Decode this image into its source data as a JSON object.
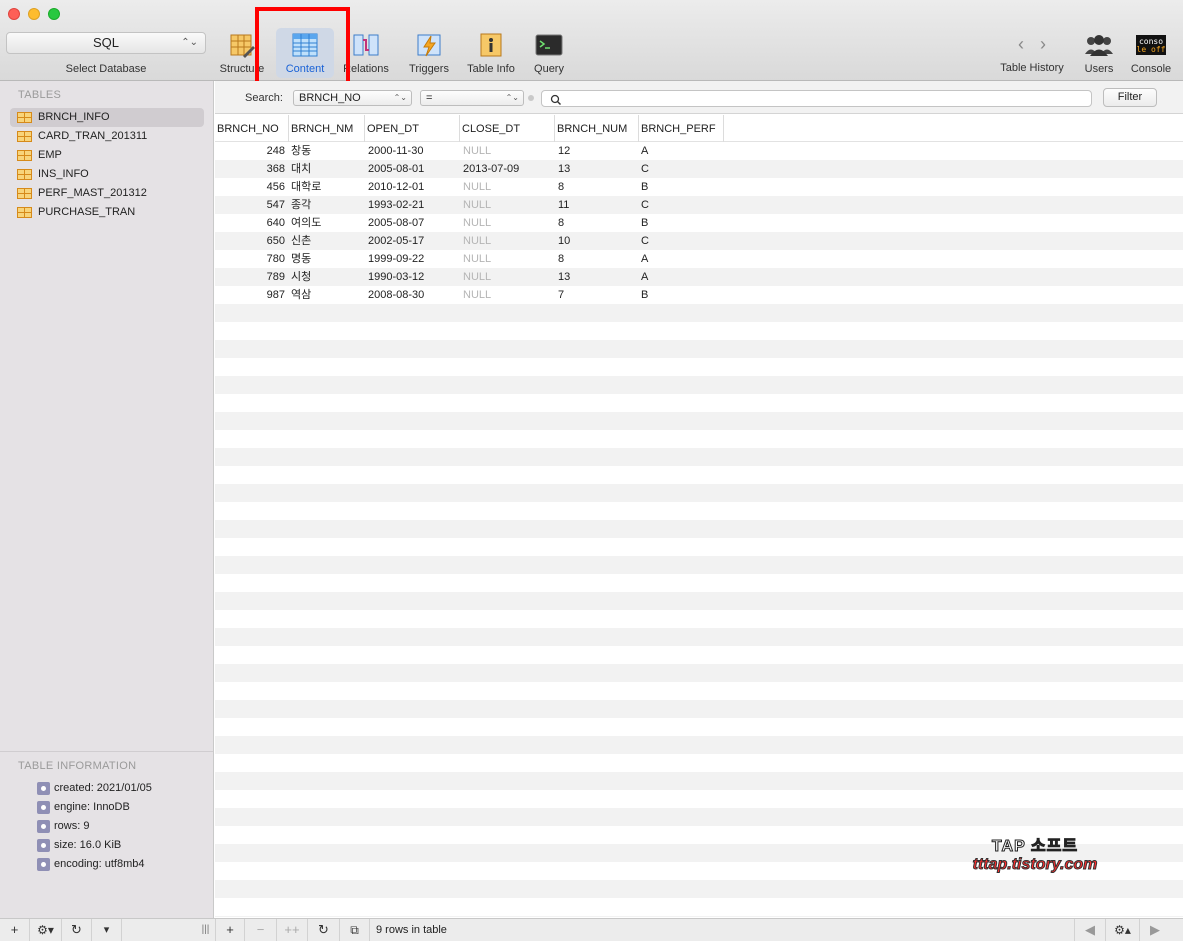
{
  "toolbar": {
    "database": "SQL",
    "database_label": "Select Database",
    "buttons": [
      {
        "label": "Structure"
      },
      {
        "label": "Content"
      },
      {
        "label": "Relations"
      },
      {
        "label": "Triggers"
      },
      {
        "label": "Table Info"
      },
      {
        "label": "Query"
      }
    ],
    "right_buttons": [
      {
        "label": "Table History"
      },
      {
        "label": "Users"
      },
      {
        "label": "Console"
      }
    ],
    "console_icon_text": [
      "conso",
      "le off"
    ],
    "active_button": "Content"
  },
  "sidebar": {
    "tables_heading": "TABLES",
    "tables": [
      "BRNCH_INFO",
      "CARD_TRAN_201311",
      "EMP",
      "INS_INFO",
      "PERF_MAST_201312",
      "PURCHASE_TRAN"
    ],
    "selected_table": "BRNCH_INFO",
    "info_heading": "TABLE INFORMATION",
    "info": [
      "created: 2021/01/05",
      "engine: InnoDB",
      "rows: 9",
      "size: 16.0 KiB",
      "encoding: utf8mb4"
    ]
  },
  "search": {
    "label": "Search:",
    "column": "BRNCH_NO",
    "operator": "=",
    "value": "",
    "filter_label": "Filter"
  },
  "grid": {
    "columns": [
      "BRNCH_NO",
      "BRNCH_NM",
      "OPEN_DT",
      "CLOSE_DT",
      "BRNCH_NUM",
      "BRNCH_PERF"
    ],
    "rows": [
      [
        "248",
        "창동",
        "2000-11-30",
        "NULL",
        "12",
        "A"
      ],
      [
        "368",
        "대치",
        "2005-08-01",
        "2013-07-09",
        "13",
        "C"
      ],
      [
        "456",
        "대학로",
        "2010-12-01",
        "NULL",
        "8",
        "B"
      ],
      [
        "547",
        "종각",
        "1993-02-21",
        "NULL",
        "11",
        "C"
      ],
      [
        "640",
        "여의도",
        "2005-08-07",
        "NULL",
        "8",
        "B"
      ],
      [
        "650",
        "신촌",
        "2002-05-17",
        "NULL",
        "10",
        "C"
      ],
      [
        "780",
        "명동",
        "1999-09-22",
        "NULL",
        "8",
        "A"
      ],
      [
        "789",
        "시청",
        "1990-03-12",
        "NULL",
        "13",
        "A"
      ],
      [
        "987",
        "역삼",
        "2008-08-30",
        "NULL",
        "7",
        "B"
      ]
    ]
  },
  "status": {
    "rows_text": "9 rows in table"
  },
  "watermark": {
    "line1": "TAP 소프트",
    "line2": "tttap.tistory.com"
  },
  "colors": {
    "accent": "#1a62d6",
    "highlight": "#ff0000",
    "null_text": "#b5b5b5"
  }
}
